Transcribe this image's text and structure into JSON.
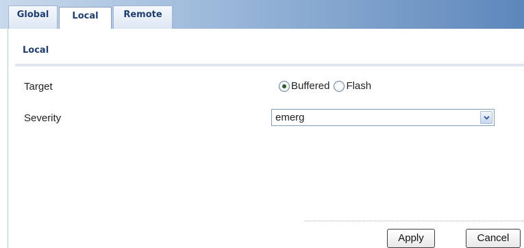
{
  "tabs": [
    {
      "label": "Global"
    },
    {
      "label": "Local"
    },
    {
      "label": "Remote"
    }
  ],
  "section": {
    "title": "Local"
  },
  "target": {
    "label": "Target",
    "options": [
      "Buffered",
      "Flash"
    ],
    "selected": "Buffered"
  },
  "severity": {
    "label": "Severity",
    "value": "emerg"
  },
  "buttons": {
    "apply": "Apply",
    "cancel": "Cancel"
  }
}
